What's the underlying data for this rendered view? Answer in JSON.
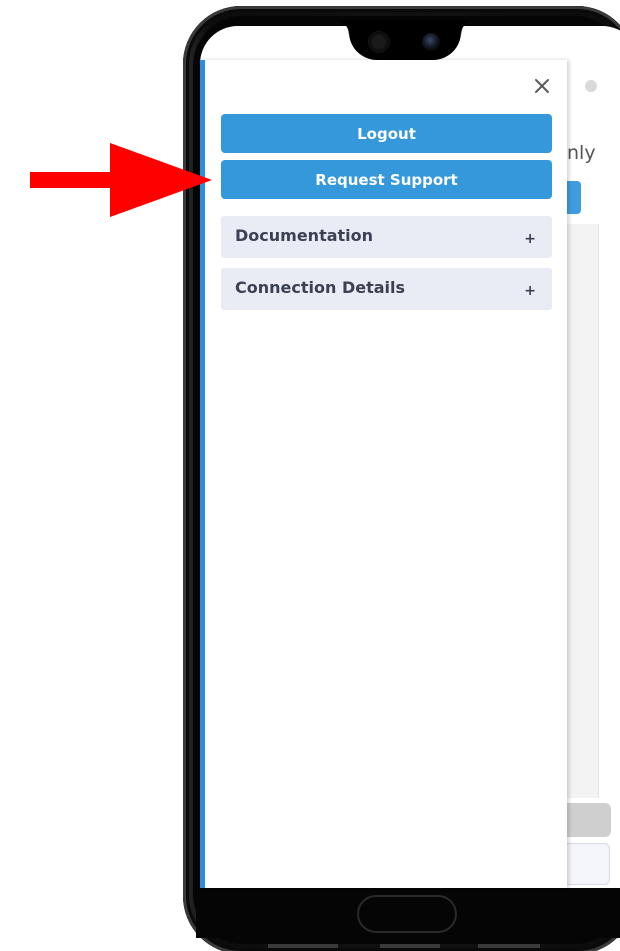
{
  "colors": {
    "primary": "#3498db",
    "drawer_accent": "#2d8fd9",
    "accordion_bg": "#e9ebf5",
    "accordion_text": "#3b4152",
    "annotation_arrow": "#ff0000"
  },
  "drawer": {
    "close_icon": "close-icon",
    "buttons": [
      {
        "label": "Logout"
      },
      {
        "label": "Request Support"
      }
    ],
    "accordions": [
      {
        "title": "Documentation",
        "toggle": "+"
      },
      {
        "title": "Connection Details",
        "toggle": "+"
      }
    ]
  },
  "background_page": {
    "text_fragment": "nly"
  }
}
